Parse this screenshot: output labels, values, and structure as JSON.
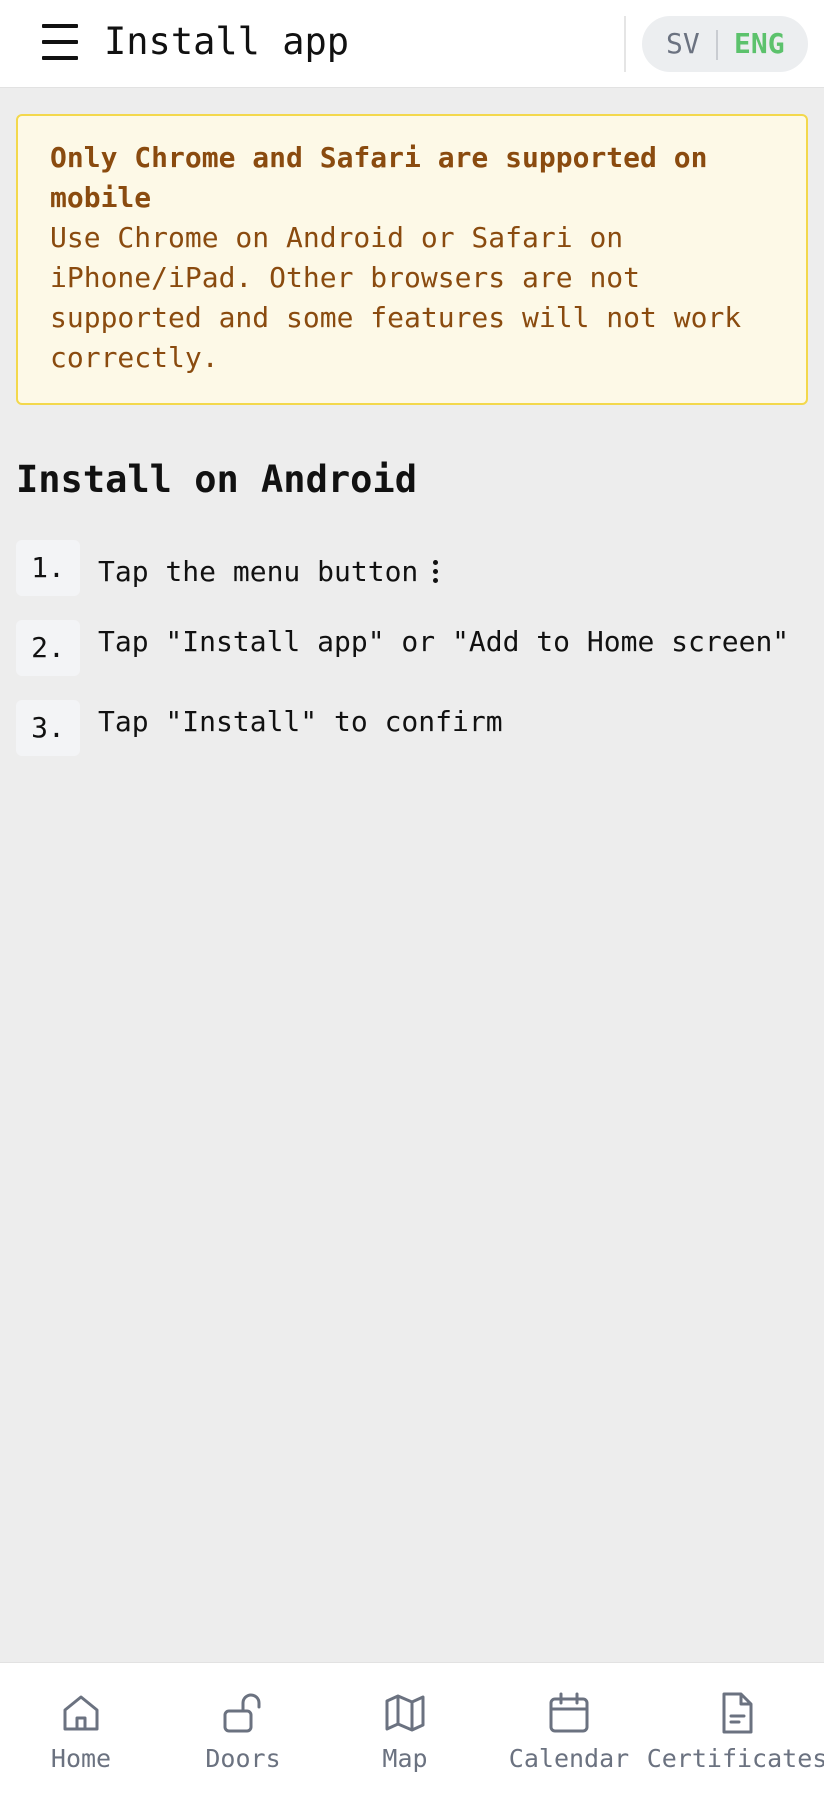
{
  "header": {
    "title": "Install app",
    "lang_sv": "SV",
    "lang_eng": "ENG"
  },
  "warning": {
    "title": "Only Chrome and Safari are supported on mobile",
    "title_line1": "Only Chrome and Safari are supported on",
    "title_line2": "mobile",
    "body_line1": "Use Chrome on Android or Safari on",
    "body_line2": "iPhone/iPad. Other browsers are not",
    "body_line3": "supported and some features will not work",
    "body_line4": "correctly."
  },
  "android": {
    "title": "Install on Android",
    "steps": [
      {
        "number": "1.",
        "text": "Tap the menu button"
      },
      {
        "number": "2.",
        "text": "Tap \"Install app\" or \"Add to Home screen\""
      },
      {
        "number": "3.",
        "text": "Tap \"Install\" to confirm"
      }
    ]
  },
  "nav": {
    "items": [
      {
        "label": "Home",
        "icon": "home-icon"
      },
      {
        "label": "Doors",
        "icon": "unlock-icon"
      },
      {
        "label": "Map",
        "icon": "map-icon"
      },
      {
        "label": "Calendar",
        "icon": "calendar-icon"
      },
      {
        "label": "Certificates",
        "icon": "document-icon"
      }
    ]
  },
  "colors": {
    "accent": "#5cc26c",
    "warning_text": "#8a4b0f",
    "warning_bg": "#fdf9e7",
    "warning_border": "#f3d84c"
  }
}
